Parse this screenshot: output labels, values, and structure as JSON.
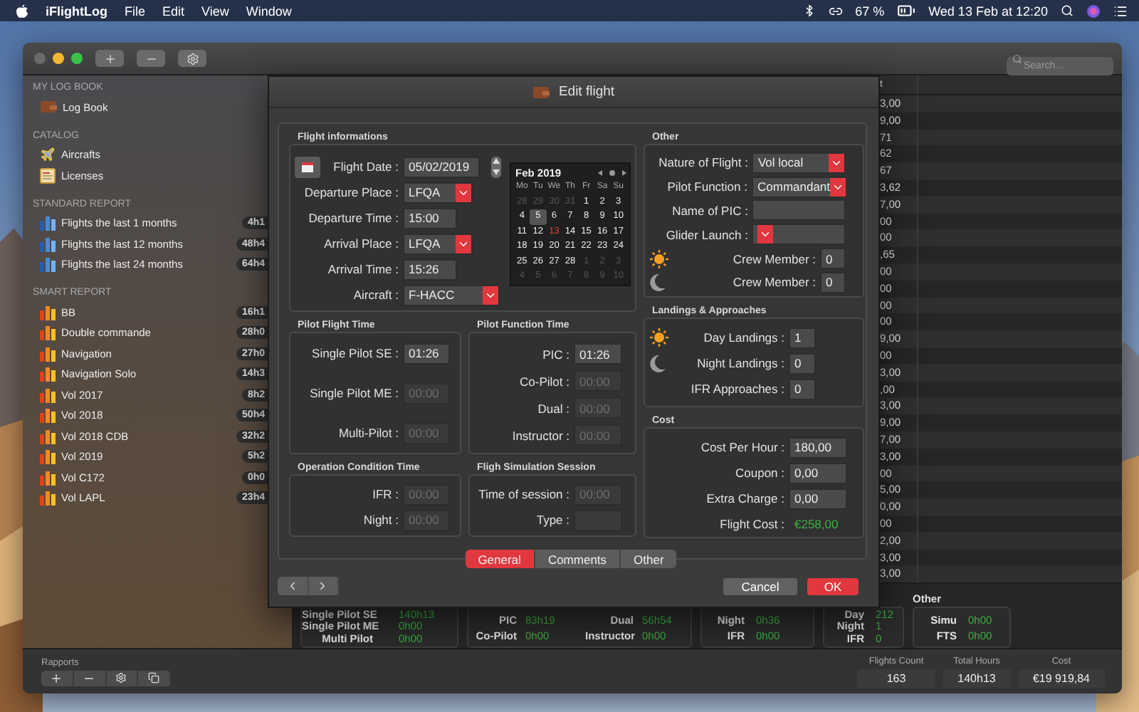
{
  "menu_bar": {
    "app_name": "iFlightLog",
    "menus": [
      "File",
      "Edit",
      "View",
      "Window"
    ],
    "battery": "67 %",
    "clock": "Wed 13 Feb at 12:20"
  },
  "toolbar": {
    "search": {
      "placeholder": "Search..."
    }
  },
  "sidebar": {
    "sections": [
      {
        "title": "MY LOG BOOK",
        "items": [
          {
            "kind": "logbook",
            "label": "Log Book"
          }
        ]
      },
      {
        "title": "CATALOG",
        "items": [
          {
            "kind": "aircraft",
            "label": "Aircrafts"
          },
          {
            "kind": "license",
            "label": "Licenses"
          }
        ]
      },
      {
        "title": "STANDARD REPORT",
        "items": [
          {
            "kind": "standard",
            "label": "Flights the last 1 months",
            "badge": "4h1"
          },
          {
            "kind": "standard",
            "label": "Flights the last 12 months",
            "badge": "48h4"
          },
          {
            "kind": "standard",
            "label": "Flights the last 24 months",
            "badge": "64h4"
          }
        ]
      },
      {
        "title": "SMART REPORT",
        "items": [
          {
            "kind": "smart",
            "label": "BB",
            "badge": "16h1"
          },
          {
            "kind": "smart",
            "label": "Double commande",
            "badge": "28h0"
          },
          {
            "kind": "smart",
            "label": "Navigation",
            "badge": "27h0"
          },
          {
            "kind": "smart",
            "label": "Navigation Solo",
            "badge": "14h3"
          },
          {
            "kind": "smart",
            "label": "Vol 2017",
            "badge": "8h2"
          },
          {
            "kind": "smart",
            "label": "Vol 2018",
            "badge": "50h4"
          },
          {
            "kind": "smart",
            "label": "Vol 2018 CDB",
            "badge": "32h2"
          },
          {
            "kind": "smart",
            "label": "Vol 2019",
            "badge": "5h2"
          },
          {
            "kind": "smart",
            "label": "Vol C172",
            "badge": "0h0"
          },
          {
            "kind": "smart",
            "label": "Vol LAPL",
            "badge": "23h4"
          }
        ]
      }
    ]
  },
  "table": {
    "column_1": {
      "header": "t",
      "cells": [
        "3,00",
        "9,00",
        "71",
        "62",
        "67",
        "3,62",
        "7,00",
        "00",
        "00",
        ",65",
        "00",
        "00",
        "00",
        "00",
        "9,00",
        "00",
        "3,00",
        ",00",
        "3,00",
        "9,00",
        "7,00",
        "3,00",
        "00",
        "5,00",
        "0,00",
        "00",
        "2,00",
        "3,00",
        "3,00"
      ]
    }
  },
  "summary": {
    "groups": [
      {
        "kind": "single",
        "rows": [
          {
            "label": "Single Pilot SE",
            "value": "140h13"
          },
          {
            "label": "Single Pilot ME",
            "value": "0h00"
          },
          {
            "label": "Multi Pilot",
            "value": "0h00"
          }
        ]
      },
      {
        "kind": "pairs",
        "rows": [
          {
            "label": "PIC",
            "value": "83h19"
          },
          {
            "label": "Dual",
            "value": "56h54"
          },
          {
            "label": "Co-Pilot",
            "value": "0h00"
          },
          {
            "label": "Instructor",
            "value": "0h00"
          }
        ]
      },
      {
        "kind": "single",
        "rows": [
          {
            "label": "Night",
            "value": "0h36"
          },
          {
            "label": "IFR",
            "value": "0h00"
          }
        ]
      },
      {
        "kind": "single",
        "rows": [
          {
            "label": "Day",
            "value": "212"
          },
          {
            "label": "Night",
            "value": "1"
          },
          {
            "label": "IFR",
            "value": "0"
          }
        ]
      },
      {
        "kind": "single",
        "title": "Other",
        "rows": [
          {
            "label": "Simu",
            "value": "0h00"
          },
          {
            "label": "FTS",
            "value": "0h00"
          }
        ]
      }
    ]
  },
  "footer": {
    "label": "Rapports",
    "totals": [
      {
        "label": "Flights Count",
        "value": "163"
      },
      {
        "label": "Total Hours",
        "value": "140h13"
      },
      {
        "label": "Cost",
        "value": "€19 919,84"
      }
    ]
  },
  "dialog": {
    "title": "Edit flight",
    "flight_info": {
      "title": "Flight informations",
      "fields": [
        {
          "kind": "date",
          "label": "Flight Date :",
          "value": "05/02/2019"
        },
        {
          "kind": "select",
          "label": "Departure Place :",
          "value": "LFQA"
        },
        {
          "kind": "text",
          "label": "Departure Time :",
          "value": "15:00"
        },
        {
          "kind": "select",
          "label": "Arrival Place :",
          "value": "LFQA"
        },
        {
          "kind": "text",
          "label": "Arrival Time :",
          "value": "15:26"
        },
        {
          "kind": "combo",
          "label": "Aircraft :",
          "value": "F-HACC"
        }
      ],
      "calendar": {
        "month": "Feb 2019",
        "weekdays": [
          "Mo",
          "Tu",
          "We",
          "Th",
          "Fr",
          "Sa",
          "Su"
        ],
        "days": [
          {
            "label": "28",
            "outside": true,
            "selected": false,
            "today": false
          },
          {
            "label": "29",
            "outside": true,
            "selected": false,
            "today": false
          },
          {
            "label": "30",
            "outside": true,
            "selected": false,
            "today": false
          },
          {
            "label": "31",
            "outside": true,
            "selected": false,
            "today": false
          },
          {
            "label": "1",
            "outside": false,
            "selected": false,
            "today": false
          },
          {
            "label": "2",
            "outside": false,
            "selected": false,
            "today": false
          },
          {
            "label": "3",
            "outside": false,
            "selected": false,
            "today": false
          },
          {
            "label": "4",
            "outside": false,
            "selected": false,
            "today": false
          },
          {
            "label": "5",
            "outside": false,
            "selected": true,
            "today": false
          },
          {
            "label": "6",
            "outside": false,
            "selected": false,
            "today": false
          },
          {
            "label": "7",
            "outside": false,
            "selected": false,
            "today": false
          },
          {
            "label": "8",
            "outside": false,
            "selected": false,
            "today": false
          },
          {
            "label": "9",
            "outside": false,
            "selected": false,
            "today": false
          },
          {
            "label": "10",
            "outside": false,
            "selected": false,
            "today": false
          },
          {
            "label": "11",
            "outside": false,
            "selected": false,
            "today": false
          },
          {
            "label": "12",
            "outside": false,
            "selected": false,
            "today": false
          },
          {
            "label": "13",
            "outside": false,
            "selected": false,
            "today": true
          },
          {
            "label": "14",
            "outside": false,
            "selected": false,
            "today": false
          },
          {
            "label": "15",
            "outside": false,
            "selected": false,
            "today": false
          },
          {
            "label": "16",
            "outside": false,
            "selected": false,
            "today": false
          },
          {
            "label": "17",
            "outside": false,
            "selected": false,
            "today": false
          },
          {
            "label": "18",
            "outside": false,
            "selected": false,
            "today": false
          },
          {
            "label": "19",
            "outside": false,
            "selected": false,
            "today": false
          },
          {
            "label": "20",
            "outside": false,
            "selected": false,
            "today": false
          },
          {
            "label": "21",
            "outside": false,
            "selected": false,
            "today": false
          },
          {
            "label": "22",
            "outside": false,
            "selected": false,
            "today": false
          },
          {
            "label": "23",
            "outside": false,
            "selected": false,
            "today": false
          },
          {
            "label": "24",
            "outside": false,
            "selected": false,
            "today": false
          },
          {
            "label": "25",
            "outside": false,
            "selected": false,
            "today": false
          },
          {
            "label": "26",
            "outside": false,
            "selected": false,
            "today": false
          },
          {
            "label": "27",
            "outside": false,
            "selected": false,
            "today": false
          },
          {
            "label": "28",
            "outside": false,
            "selected": false,
            "today": false
          },
          {
            "label": "1",
            "outside": true,
            "selected": false,
            "today": false
          },
          {
            "label": "2",
            "outside": true,
            "selected": false,
            "today": false
          },
          {
            "label": "3",
            "outside": true,
            "selected": false,
            "today": false
          },
          {
            "label": "4",
            "outside": true,
            "selected": false,
            "today": false
          },
          {
            "label": "5",
            "outside": true,
            "selected": false,
            "today": false
          },
          {
            "label": "6",
            "outside": true,
            "selected": false,
            "today": false
          },
          {
            "label": "7",
            "outside": true,
            "selected": false,
            "today": false
          },
          {
            "label": "8",
            "outside": true,
            "selected": false,
            "today": false
          },
          {
            "label": "9",
            "outside": true,
            "selected": false,
            "today": false
          },
          {
            "label": "10",
            "outside": true,
            "selected": false,
            "today": false
          }
        ]
      }
    },
    "pilot_flight_time": {
      "title": "Pilot Flight Time",
      "fields": [
        {
          "label": "Single Pilot SE :",
          "value": "01:26",
          "disabled": false
        },
        {
          "label": "Single Pilot ME :",
          "value": "00:00",
          "disabled": true
        },
        {
          "label": "Multi-Pilot :",
          "value": "00:00",
          "disabled": true
        }
      ]
    },
    "pilot_function_time": {
      "title": "Pilot Function Time",
      "fields": [
        {
          "label": "PIC :",
          "value": "01:26",
          "disabled": false
        },
        {
          "label": "Co-Pilot :",
          "value": "00:00",
          "disabled": true
        },
        {
          "label": "Dual :",
          "value": "00:00",
          "disabled": true
        },
        {
          "label": "Instructor :",
          "value": "00:00",
          "disabled": true
        }
      ]
    },
    "operation_condition_time": {
      "title": "Operation Condition Time",
      "fields": [
        {
          "label": "IFR :",
          "value": "00:00",
          "disabled": true
        },
        {
          "label": "Night :",
          "value": "00:00",
          "disabled": true
        }
      ]
    },
    "simulation_session": {
      "title": "Fligh Simulation Session",
      "fields": [
        {
          "label": "Time of session :",
          "value": "00:00",
          "disabled": true
        },
        {
          "label": "Type :",
          "disabled": true
        }
      ]
    },
    "other": {
      "title": "Other",
      "fields": [
        {
          "kind": "select",
          "label": "Nature of Flight :",
          "value": "Vol local"
        },
        {
          "kind": "select",
          "label": "Pilot Function :",
          "value": "Commandant"
        },
        {
          "kind": "text",
          "label": "Name of PIC :"
        },
        {
          "kind": "select",
          "label": "Glider Launch :"
        },
        {
          "kind": "day",
          "label": "Crew Member :",
          "value": "0"
        },
        {
          "kind": "night",
          "label": "Crew Member :",
          "value": "0"
        }
      ]
    },
    "landings": {
      "title": "Landings & Approaches",
      "fields": [
        {
          "kind": "day",
          "label": "Day Landings :",
          "value": "1"
        },
        {
          "kind": "night",
          "label": "Night Landings :",
          "value": "0"
        },
        {
          "kind": "plain",
          "label": "IFR Approaches :",
          "value": "0"
        }
      ]
    },
    "cost": {
      "title": "Cost",
      "fields": [
        {
          "kind": "plain",
          "label": "Cost Per Hour :",
          "value": "180,00"
        },
        {
          "kind": "plain",
          "label": "Coupon :",
          "value": "0,00"
        },
        {
          "kind": "plain",
          "label": "Extra Charge :",
          "value": "0,00"
        },
        {
          "kind": "result",
          "label": "Flight Cost :",
          "value": "€258,00"
        }
      ]
    },
    "tabs": [
      {
        "label": "General",
        "selected": true
      },
      {
        "label": "Comments",
        "selected": false
      },
      {
        "label": "Other",
        "selected": false
      }
    ],
    "buttons": [
      {
        "kind": "cancel",
        "label": "Cancel"
      },
      {
        "kind": "ok",
        "label": "OK"
      }
    ]
  }
}
